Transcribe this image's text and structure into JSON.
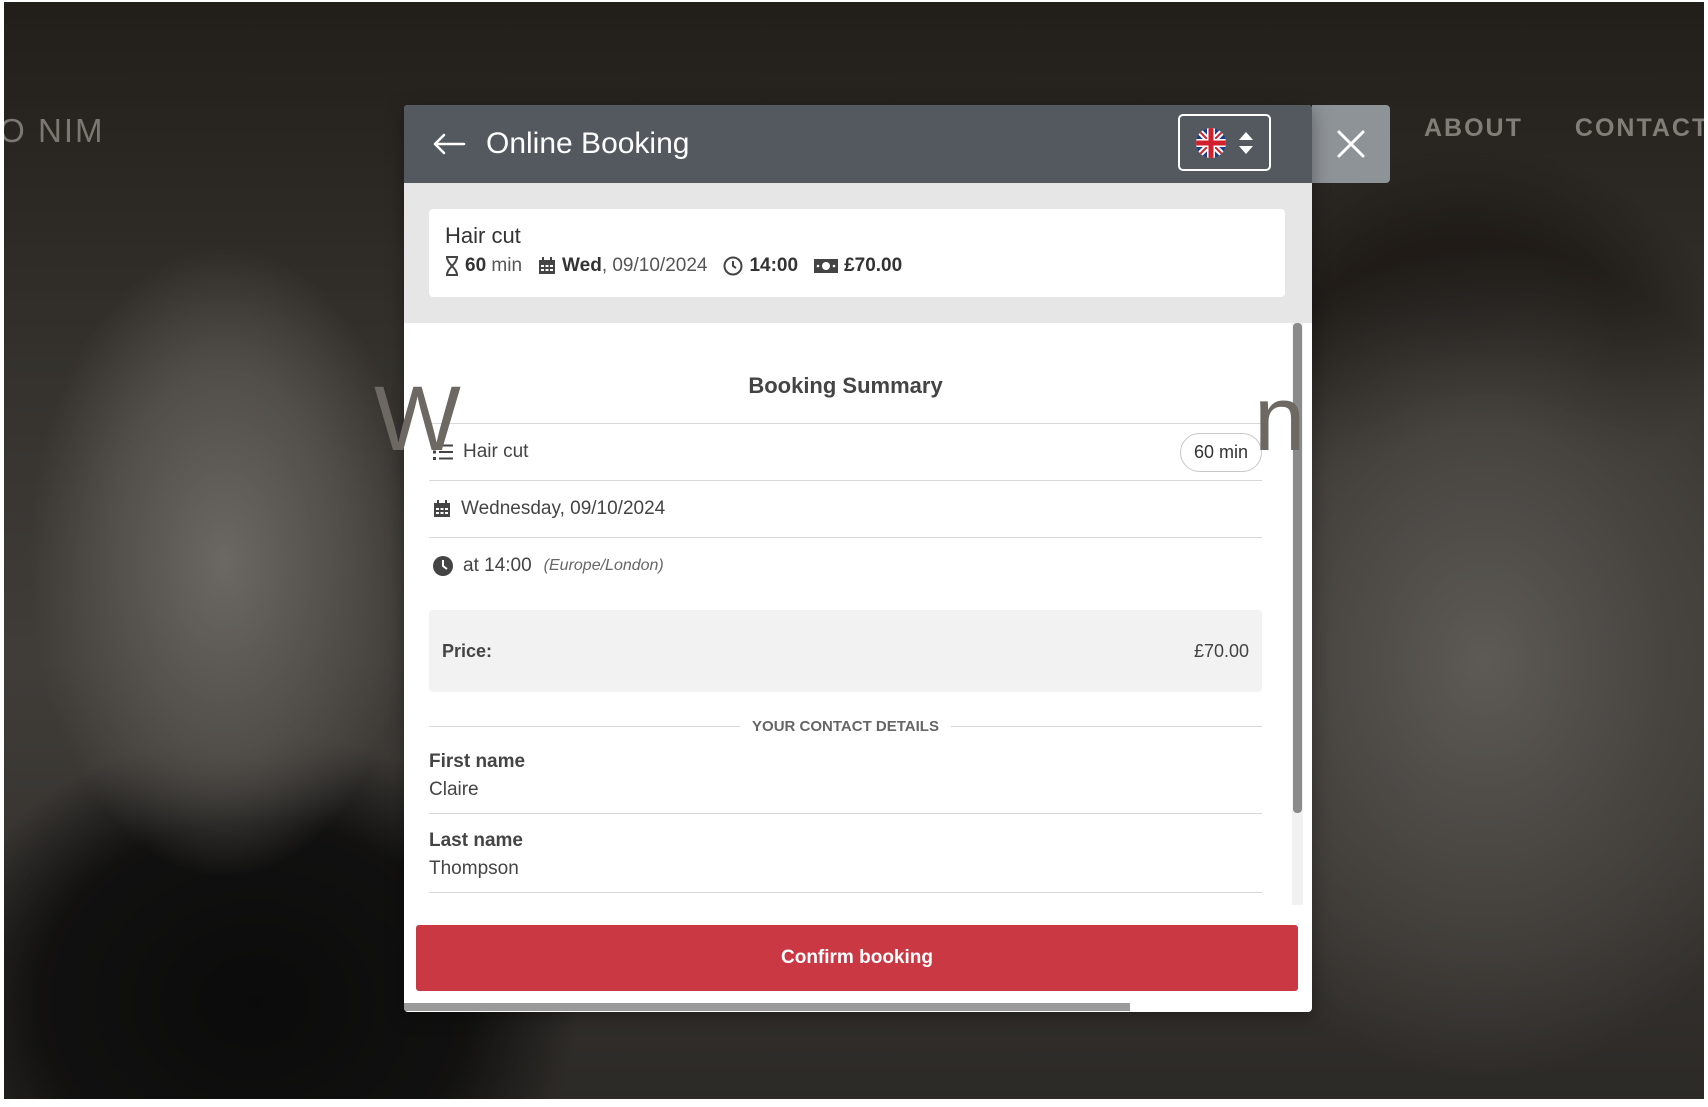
{
  "site": {
    "brand": "IO NIM",
    "nav": [
      "ABOUT",
      "CONTACT"
    ],
    "hero_left": "W",
    "hero_right": "n"
  },
  "modal": {
    "title": "Online Booking",
    "language": "English (UK)",
    "service": {
      "name": "Hair cut",
      "duration_value": "60",
      "duration_unit": "min",
      "day": "Wed",
      "date": ", 09/10/2024",
      "time": "14:00",
      "price": "£70.00"
    },
    "summary": {
      "title": "Booking Summary",
      "service_name": "Hair cut",
      "duration": "60 min",
      "date_full": "Wednesday, 09/10/2024",
      "time": "at 14:00",
      "timezone": "(Europe/London)"
    },
    "price": {
      "label": "Price:",
      "value": "£70.00"
    },
    "contact": {
      "heading": "YOUR CONTACT DETAILS",
      "fields": [
        {
          "label": "First name",
          "value": "Claire"
        },
        {
          "label": "Last name",
          "value": "Thompson"
        }
      ]
    },
    "confirm_label": "Confirm booking"
  },
  "colors": {
    "header": "#53595f",
    "confirm": "#c93843",
    "close_box": "#8e9397"
  }
}
